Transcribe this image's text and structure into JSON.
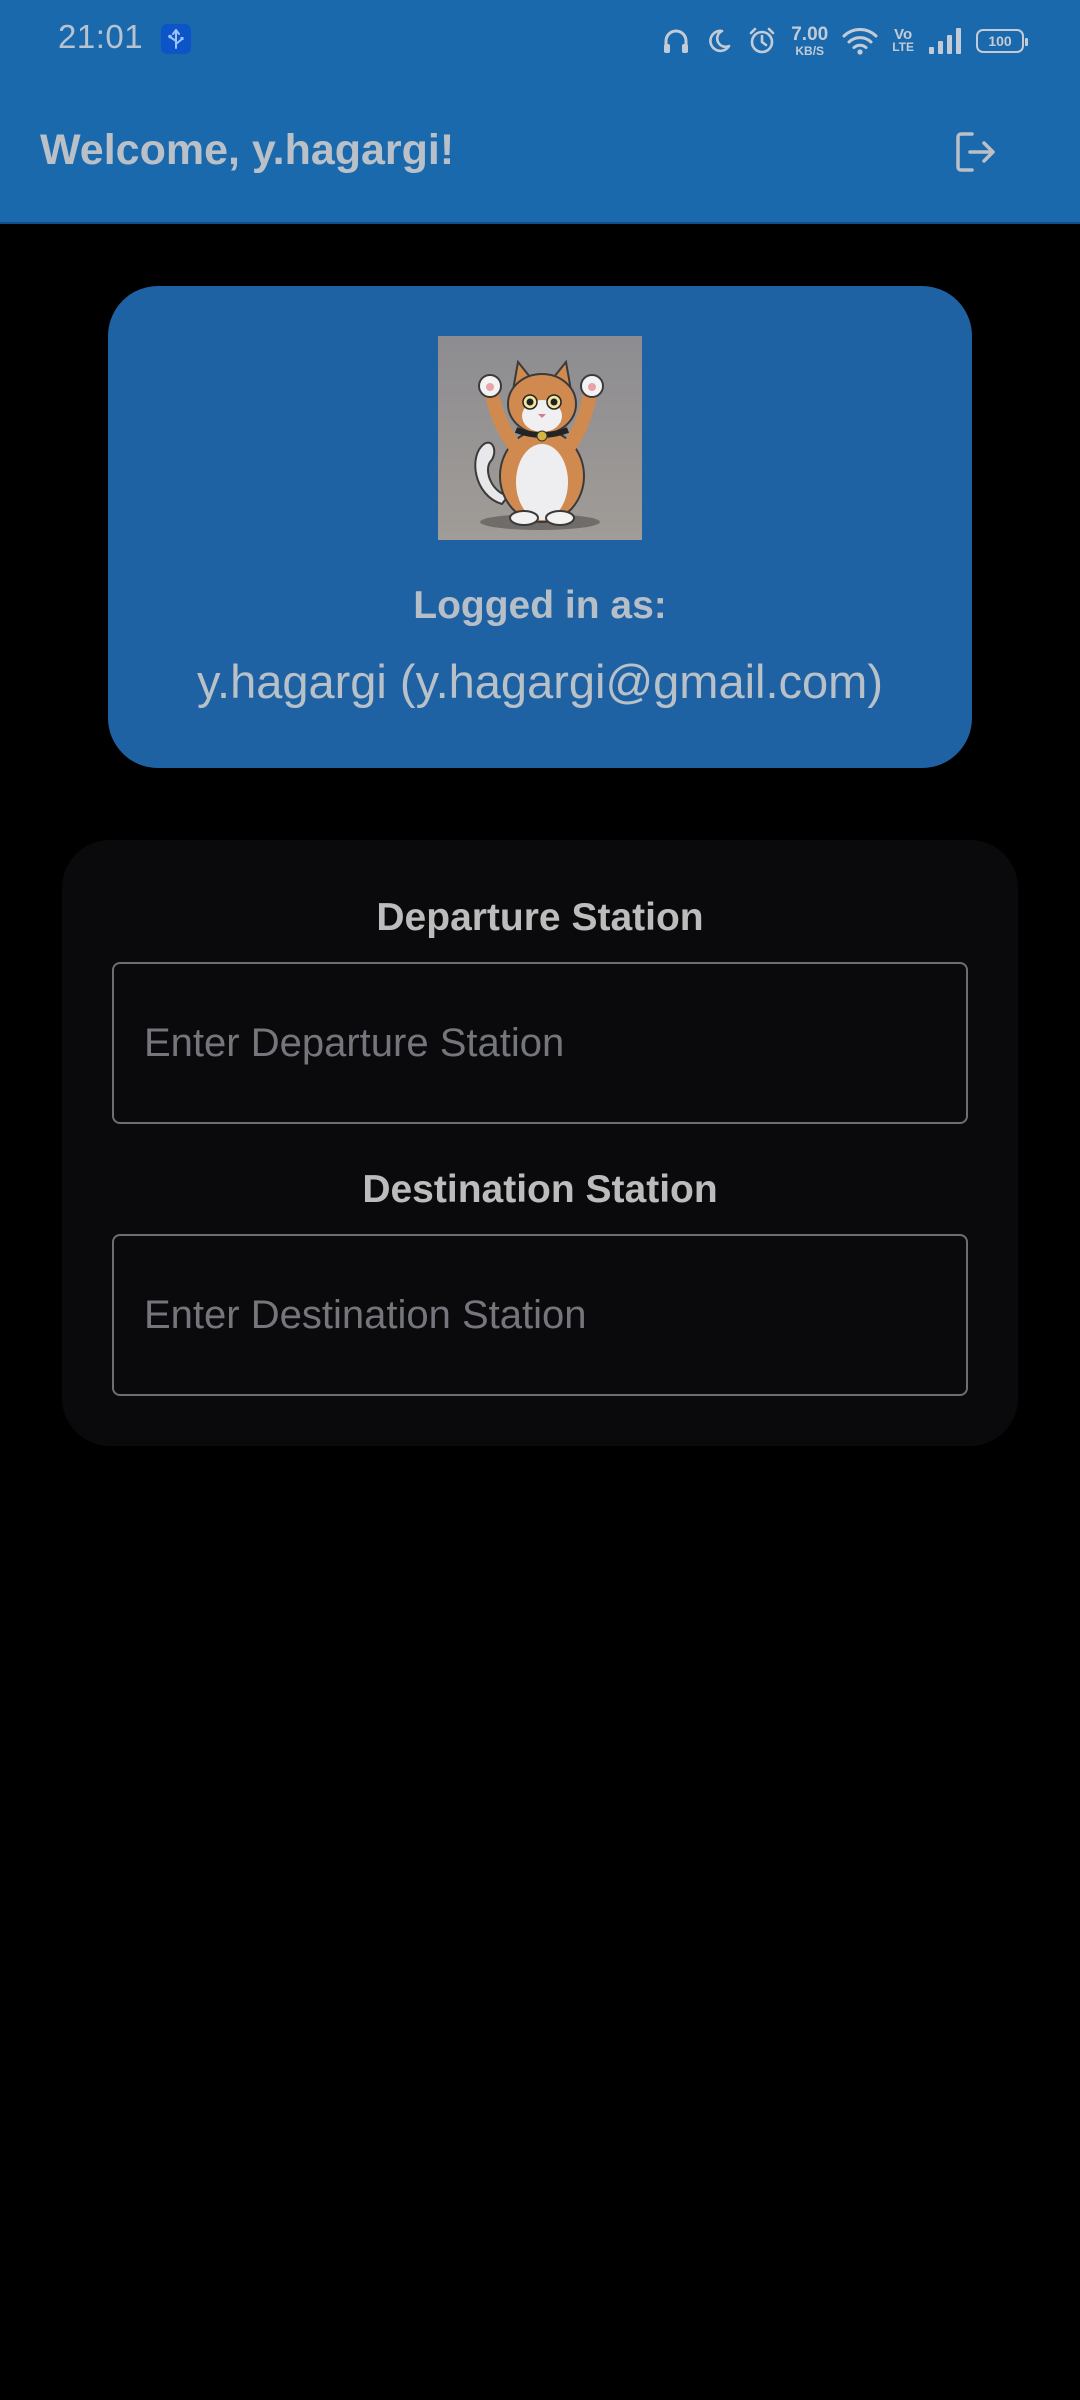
{
  "status_bar": {
    "time": "21:01",
    "net_speed_value": "7.00",
    "net_speed_unit": "KB/S",
    "volte_top": "Vo",
    "volte_bottom": "LTE",
    "battery": "100",
    "icons": [
      "usb-icon",
      "headphones-icon",
      "moon-icon",
      "alarm-icon",
      "wifi-icon",
      "signal-icon",
      "battery-icon"
    ]
  },
  "app_bar": {
    "title": "Welcome, y.hagargi!",
    "action_icon": "logout-icon",
    "background": "#1b69ad"
  },
  "profile": {
    "avatar_icon": "cat-avatar-icon",
    "label": "Logged in as:",
    "user": "y.hagargi (y.hagargi@gmail.com)",
    "card_color": "#1f62a3"
  },
  "stations": {
    "departure_label": "Departure Station",
    "departure_placeholder": "Enter Departure Station",
    "departure_value": "",
    "destination_label": "Destination Station",
    "destination_placeholder": "Enter Destination Station",
    "destination_value": ""
  }
}
